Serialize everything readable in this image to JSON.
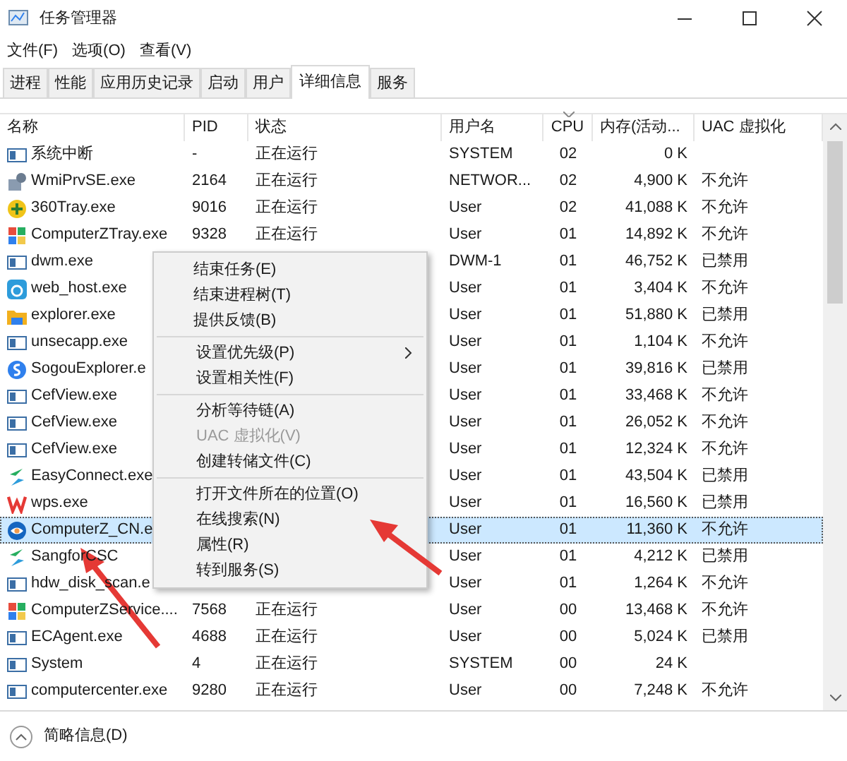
{
  "window": {
    "title": "任务管理器"
  },
  "menu_bar": [
    "文件(F)",
    "选项(O)",
    "查看(V)"
  ],
  "tabs": [
    {
      "label": "进程",
      "selected": false
    },
    {
      "label": "性能",
      "selected": false
    },
    {
      "label": "应用历史记录",
      "selected": false
    },
    {
      "label": "启动",
      "selected": false
    },
    {
      "label": "用户",
      "selected": false
    },
    {
      "label": "详细信息",
      "selected": true
    },
    {
      "label": "服务",
      "selected": false
    }
  ],
  "table": {
    "columns": [
      "名称",
      "PID",
      "状态",
      "用户名",
      "CPU",
      "内存(活动...",
      "UAC 虚拟化"
    ],
    "rows": [
      {
        "kind": "window",
        "selected": false,
        "name": "系统中断",
        "pid": "-",
        "status": "正在运行",
        "user": "SYSTEM",
        "cpu": "02",
        "memory": "0 K"
      },
      {
        "kind": "gear",
        "selected": false,
        "name": "WmiPrvSE.exe",
        "pid": "2164",
        "status": "正在运行",
        "user": "NETWOR...",
        "cpu": "02",
        "memory": "4,900 K",
        "uac": "不允许"
      },
      {
        "kind": "plus",
        "selected": false,
        "name": "360Tray.exe",
        "pid": "9016",
        "status": "正在运行",
        "user": "User",
        "cpu": "02",
        "memory": "41,088 K",
        "uac": "不允许"
      },
      {
        "kind": "flag",
        "selected": false,
        "name": "ComputerZTray.exe",
        "pid": "9328",
        "status": "正在运行",
        "user": "User",
        "cpu": "01",
        "memory": "14,892 K",
        "uac": "不允许"
      },
      {
        "kind": "window",
        "selected": false,
        "name": "dwm.exe",
        "user": "DWM-1",
        "cpu": "01",
        "memory": "46,752 K",
        "uac": "已禁用"
      },
      {
        "kind": "app",
        "selected": false,
        "name": "web_host.exe",
        "user": "User",
        "cpu": "01",
        "memory": "3,404 K",
        "uac": "不允许"
      },
      {
        "kind": "folder",
        "selected": false,
        "name": "explorer.exe",
        "user": "User",
        "cpu": "01",
        "memory": "51,880 K",
        "uac": "已禁用"
      },
      {
        "kind": "window",
        "selected": false,
        "name": "unsecapp.exe",
        "user": "User",
        "cpu": "01",
        "memory": "1,104 K",
        "uac": "不允许"
      },
      {
        "kind": "globe",
        "selected": false,
        "name": "SogouExplorer.e",
        "user": "User",
        "cpu": "01",
        "memory": "39,816 K",
        "uac": "已禁用"
      },
      {
        "kind": "window",
        "selected": false,
        "name": "CefView.exe",
        "user": "User",
        "cpu": "01",
        "memory": "33,468 K",
        "uac": "不允许"
      },
      {
        "kind": "window",
        "selected": false,
        "name": "CefView.exe",
        "user": "User",
        "cpu": "01",
        "memory": "26,052 K",
        "uac": "不允许"
      },
      {
        "kind": "window",
        "selected": false,
        "name": "CefView.exe",
        "user": "User",
        "cpu": "01",
        "memory": "12,324 K",
        "uac": "不允许"
      },
      {
        "kind": "swoosh",
        "selected": false,
        "name": "EasyConnect.exe",
        "user": "User",
        "cpu": "01",
        "memory": "43,504 K",
        "uac": "已禁用"
      },
      {
        "kind": "wps",
        "selected": false,
        "name": "wps.exe",
        "user": "User",
        "cpu": "01",
        "memory": "16,560 K",
        "uac": "已禁用"
      },
      {
        "kind": "eye",
        "selected": true,
        "name": "ComputerZ_CN.e",
        "user": "User",
        "cpu": "01",
        "memory": "11,360 K",
        "uac": "不允许"
      },
      {
        "kind": "swoosh",
        "selected": false,
        "name": "SangforCSC",
        "user": "User",
        "cpu": "01",
        "memory": "4,212 K",
        "uac": "已禁用"
      },
      {
        "kind": "window",
        "selected": false,
        "name": "hdw_disk_scan.e",
        "user": "User",
        "cpu": "01",
        "memory": "1,264 K",
        "uac": "不允许"
      },
      {
        "kind": "flag",
        "selected": false,
        "name": "ComputerZService....",
        "pid": "7568",
        "status": "正在运行",
        "user": "User",
        "cpu": "00",
        "memory": "13,468 K",
        "uac": "不允许"
      },
      {
        "kind": "window",
        "selected": false,
        "name": "ECAgent.exe",
        "pid": "4688",
        "status": "正在运行",
        "user": "User",
        "cpu": "00",
        "memory": "5,024 K",
        "uac": "已禁用"
      },
      {
        "kind": "window",
        "selected": false,
        "name": "System",
        "pid": "4",
        "status": "正在运行",
        "user": "SYSTEM",
        "cpu": "00",
        "memory": "24 K"
      },
      {
        "kind": "window",
        "selected": false,
        "name": "computercenter.exe",
        "pid": "9280",
        "status": "正在运行",
        "user": "User",
        "cpu": "00",
        "memory": "7,248 K",
        "uac": "不允许"
      }
    ]
  },
  "context_menu": {
    "groups": [
      [
        {
          "label": "结束任务(E)",
          "disabled": false,
          "submenu": false
        },
        {
          "label": "结束进程树(T)",
          "disabled": false,
          "submenu": false
        },
        {
          "label": "提供反馈(B)",
          "disabled": false,
          "submenu": false
        }
      ],
      [
        {
          "label": "设置优先级(P)",
          "disabled": false,
          "submenu": true
        },
        {
          "label": "设置相关性(F)",
          "disabled": false,
          "submenu": false
        }
      ],
      [
        {
          "label": "分析等待链(A)",
          "disabled": false,
          "submenu": false
        },
        {
          "label": "UAC 虚拟化(V)",
          "disabled": true,
          "submenu": false
        },
        {
          "label": "创建转储文件(C)",
          "disabled": false,
          "submenu": false
        }
      ],
      [
        {
          "label": "打开文件所在的位置(O)",
          "disabled": false,
          "submenu": false
        },
        {
          "label": "在线搜索(N)",
          "disabled": false,
          "submenu": false
        },
        {
          "label": "属性(R)",
          "disabled": false,
          "submenu": false
        },
        {
          "label": "转到服务(S)",
          "disabled": false,
          "submenu": false
        }
      ]
    ]
  },
  "footer": {
    "label": "简略信息(D)"
  }
}
